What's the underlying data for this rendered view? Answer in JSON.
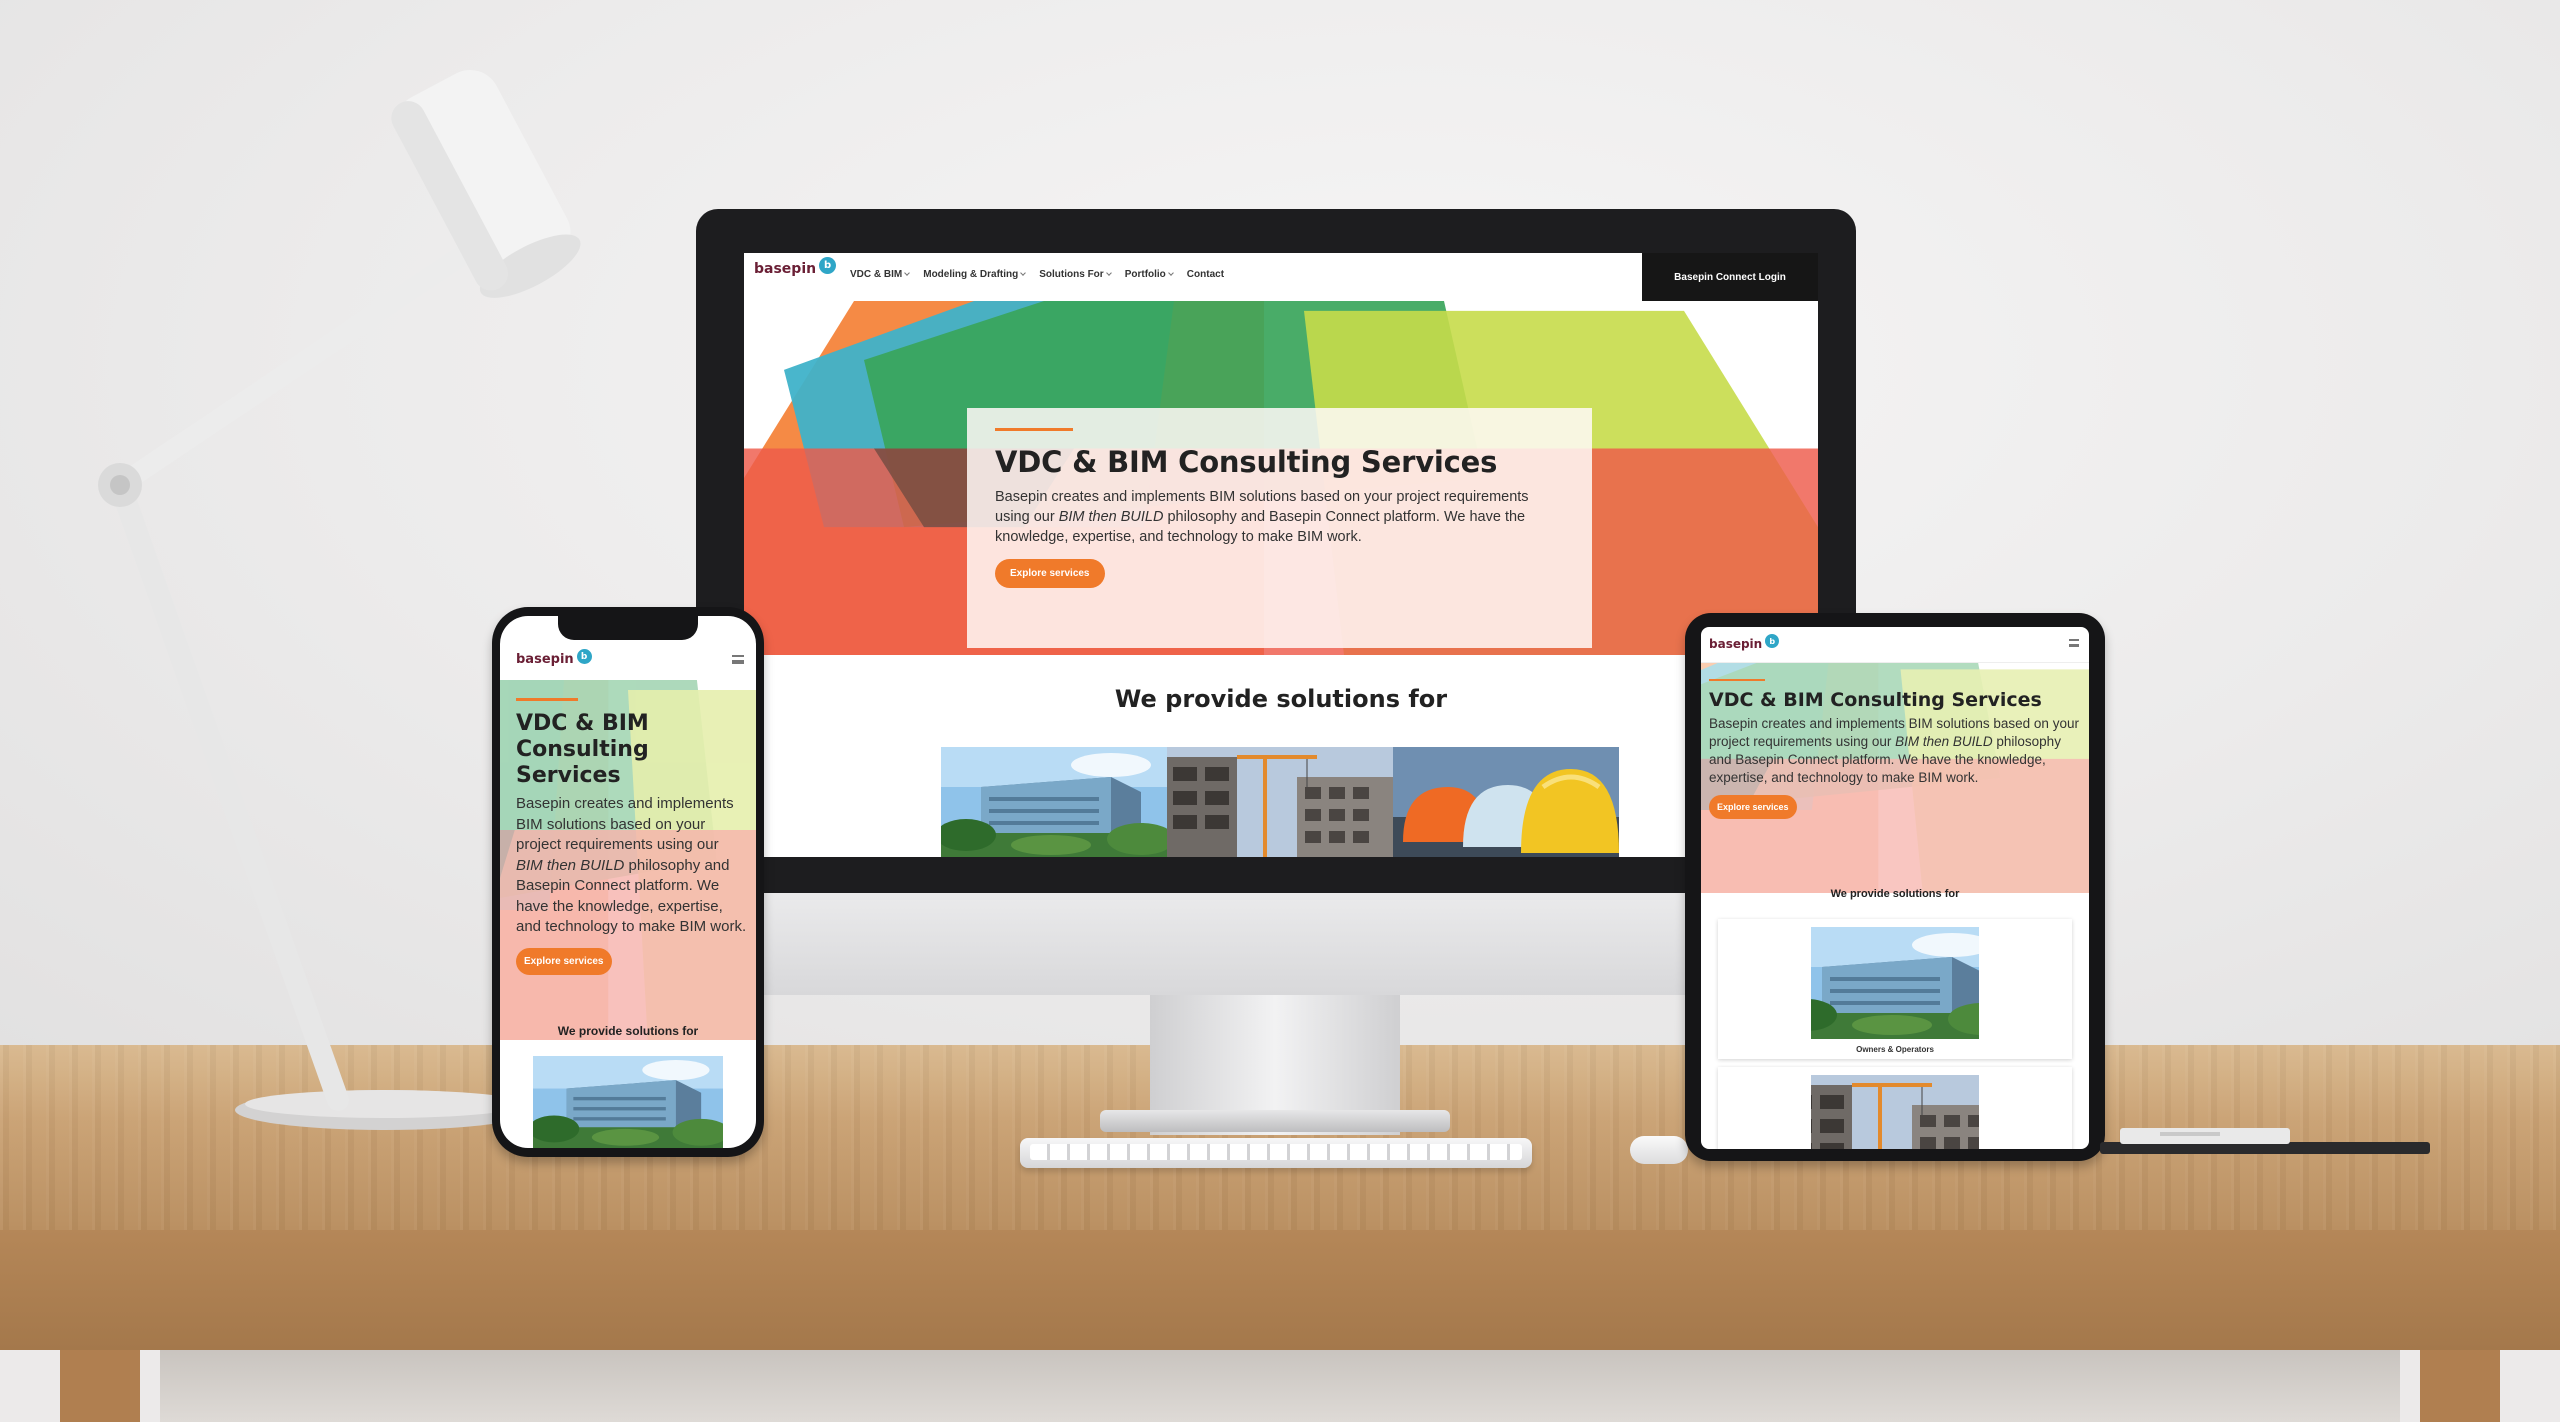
{
  "brand": {
    "logo_text": "basepin",
    "logo_badge": "b",
    "accent_color": "#f07a2a",
    "logo_color": "#6a1f35",
    "badge_color": "#2fa6c7"
  },
  "desktop": {
    "nav": {
      "items": [
        {
          "label": "VDC & BIM",
          "has_dropdown": true
        },
        {
          "label": "Modeling & Drafting",
          "has_dropdown": true
        },
        {
          "label": "Solutions For",
          "has_dropdown": true
        },
        {
          "label": "Portfolio",
          "has_dropdown": true
        },
        {
          "label": "Contact",
          "has_dropdown": false
        }
      ],
      "login_label": "Basepin Connect Login"
    },
    "hero": {
      "title": "VDC & BIM Consulting Services",
      "body_before": "Basepin creates and implements BIM solutions based on your project requirements using our ",
      "body_emphasis": "BIM then BUILD",
      "body_after": " philosophy and Basepin Connect platform. We have the knowledge, expertise, and technology to make BIM work.",
      "button_label": "Explore services"
    },
    "solutions": {
      "title": "We provide solutions for",
      "tiles": [
        "modern-building-photo",
        "construction-site-photo",
        "hard-hats-photo"
      ]
    }
  },
  "phone": {
    "hero": {
      "title": "VDC & BIM Consulting Services",
      "body_before": "Basepin creates and implements BIM solutions based on your project requirements using our ",
      "body_emphasis": "BIM then BUILD",
      "body_after": " philosophy and Basepin Connect platform. We have the knowledge, expertise, and technology to make BIM work.",
      "button_label": "Explore services"
    },
    "solutions_title": "We provide solutions for",
    "menu_icon": "hamburger-icon"
  },
  "tablet": {
    "hero": {
      "title": "VDC & BIM Consulting Services",
      "body_before": "Basepin creates and implements BIM solutions based on your project requirements using our ",
      "body_emphasis": "BIM then BUILD",
      "body_after": " philosophy and Basepin Connect platform. We have the knowledge, expertise, and technology to make BIM work.",
      "button_label": "Explore services"
    },
    "solutions_title": "We provide solutions for",
    "cards": [
      {
        "caption": "Owners & Operators",
        "image": "modern-building-photo"
      },
      {
        "caption": "",
        "image": "construction-site-photo"
      }
    ],
    "menu_icon": "hamburger-icon"
  }
}
